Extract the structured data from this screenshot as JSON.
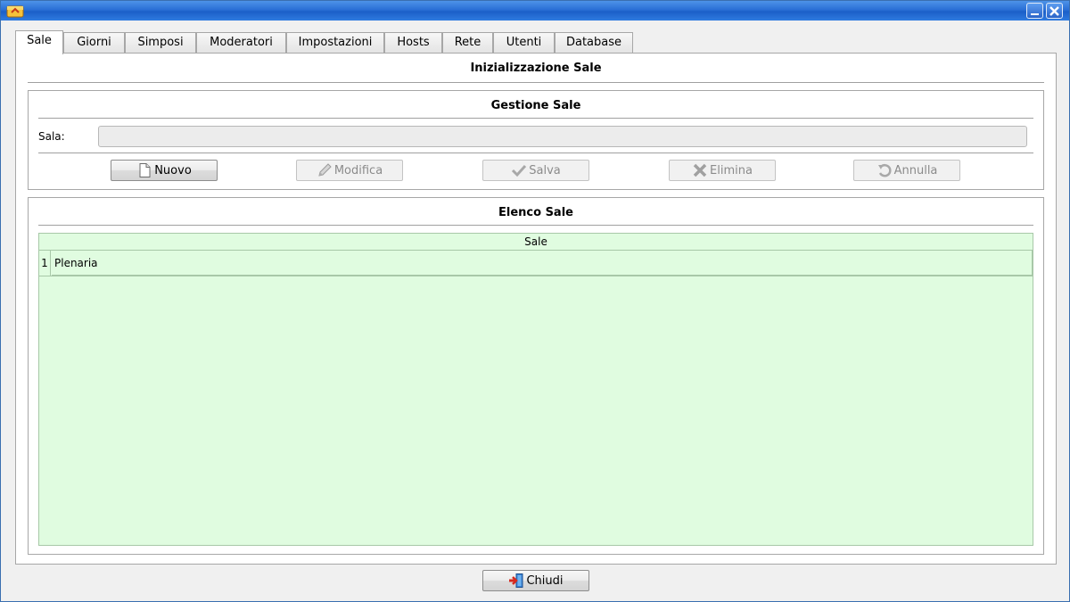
{
  "window": {
    "title": ""
  },
  "tabs": [
    {
      "label": "Sale",
      "active": true
    },
    {
      "label": "Giorni"
    },
    {
      "label": "Simposi"
    },
    {
      "label": "Moderatori"
    },
    {
      "label": "Impostazioni"
    },
    {
      "label": "Hosts"
    },
    {
      "label": "Rete"
    },
    {
      "label": "Utenti"
    },
    {
      "label": "Database"
    }
  ],
  "page": {
    "title": "Inizializzazione Sale"
  },
  "gestione": {
    "title": "Gestione Sale",
    "sala_label": "Sala:",
    "sala_value": "",
    "buttons": {
      "nuovo": "Nuovo",
      "modifica": "Modifica",
      "salva": "Salva",
      "elimina": "Elimina",
      "annulla": "Annulla"
    }
  },
  "elenco": {
    "title": "Elenco Sale",
    "column": "Sale",
    "rows": [
      {
        "num": "1",
        "name": "Plenaria"
      }
    ]
  },
  "footer": {
    "chiudi": "Chiudi"
  },
  "colors": {
    "grid_bg": "#e0fce0",
    "titlebar": "#2a6fd6"
  },
  "icons": {
    "app": "app-icon",
    "nuovo": "new-document-icon",
    "modifica": "pencil-icon",
    "salva": "checkmark-icon",
    "elimina": "x-icon",
    "annulla": "undo-icon",
    "chiudi": "exit-door-icon"
  }
}
